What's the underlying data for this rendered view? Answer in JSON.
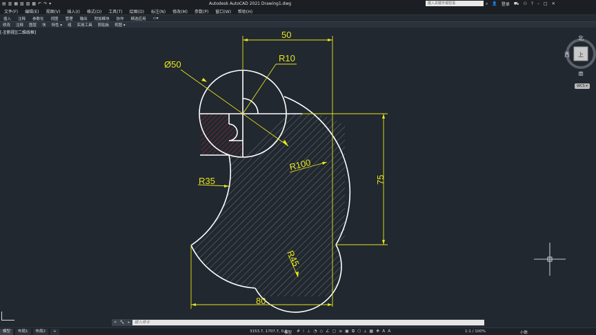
{
  "app": {
    "title": "Autodesk AutoCAD 2021    Drawing1.dwg",
    "search_placeholder": "键入关键字或短语",
    "login_label": "登录"
  },
  "menu": {
    "left": [
      "文件(F)",
      "编辑(E)",
      "视图(V)",
      "插入(I)",
      "格式(O)",
      "工具(T)",
      "绘图(D)",
      "标注(N)"
    ],
    "right": [
      "修改(M)",
      "参数(P)",
      "窗口(W)",
      "帮助(H)"
    ]
  },
  "ribbon_tabs": [
    "插入",
    "注释",
    "参数化",
    "视图",
    "管理",
    "输出",
    "附加模块",
    "协作",
    "精选应用",
    "▭▾"
  ],
  "ribbon_panels": [
    "修改",
    "注释",
    "图层",
    "块",
    "特性 ▾",
    "组",
    "实用工具",
    "剪贴板",
    "视图 ▾"
  ],
  "view_label": "[-][俯视][二维线框]",
  "viewcube": {
    "north": "北",
    "west": "西",
    "south": "南",
    "face": "上"
  },
  "wcs_label": "WCS ▾",
  "dimensions": {
    "d50_top": "50",
    "r10": "R10",
    "dia50": "Ø50",
    "r35": "R35",
    "r100": "R100",
    "d75": "75",
    "r45": "R45",
    "d80": "80"
  },
  "command": {
    "placeholder": "键入命令"
  },
  "status": {
    "layout_tabs": [
      "模型",
      "布局1",
      "布局2",
      "+"
    ],
    "coords": "3153.7, 1707.7, 0.0",
    "model_label": "模型",
    "scale": "1:1 / 100%",
    "units": "小数"
  },
  "colors": {
    "background": "#212830",
    "geometry": "#ffffff",
    "dimension": "#e8e51c",
    "hatch": "#8a8a8a",
    "hatch_red": "#c0283a"
  }
}
